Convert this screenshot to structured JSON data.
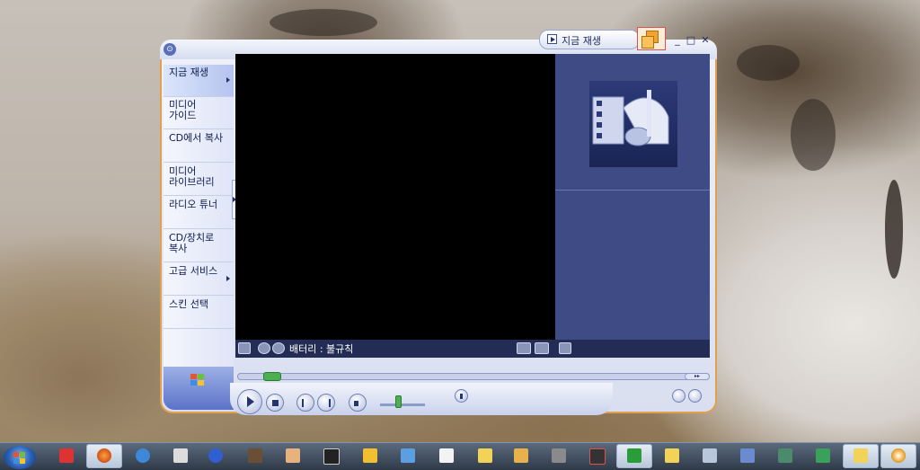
{
  "player": {
    "title_tab": "지금 재생",
    "menu_glyph": "⊙",
    "controls": {
      "minimize": "_",
      "maximize": "□",
      "close": "✕"
    },
    "nav_items": [
      {
        "label": "지금 재생",
        "active": true,
        "has_arrow": true
      },
      {
        "label": "미디어 가이드",
        "active": false,
        "has_arrow": false
      },
      {
        "label": "CD에서 복사",
        "active": false,
        "has_arrow": false
      },
      {
        "label": "미디어 라이브러리",
        "active": false,
        "has_arrow": false
      },
      {
        "label": "라디오 튜너",
        "active": false,
        "has_arrow": false
      },
      {
        "label": "CD/장치로 복사",
        "active": false,
        "has_arrow": false
      },
      {
        "label": "고급 서비스",
        "active": false,
        "has_arrow": true
      },
      {
        "label": "스킨 선택",
        "active": false,
        "has_arrow": false
      }
    ],
    "status_text": "배터리 : 불규칙",
    "seek_fraction": 0.06,
    "volume_fraction": 0.4,
    "seek_labels": {
      "left": "◂◂",
      "right": "▸▸"
    },
    "colors": {
      "accent": "#e0a050",
      "video_bg": "#000000",
      "panel_bg": "#3e4b85",
      "nav_active": "#b4c4ef"
    }
  },
  "icons": [
    "menu-icon",
    "now-playing-icon",
    "compact-mode-icon",
    "windows-logo-icon",
    "album-art-icon",
    "play-icon",
    "stop-icon",
    "previous-icon",
    "next-icon",
    "mute-icon",
    "equalizer-icon",
    "start-orb-icon",
    "firefox-icon",
    "internet-explorer-icon",
    "folder-icon",
    "recycle-bin-icon"
  ]
}
